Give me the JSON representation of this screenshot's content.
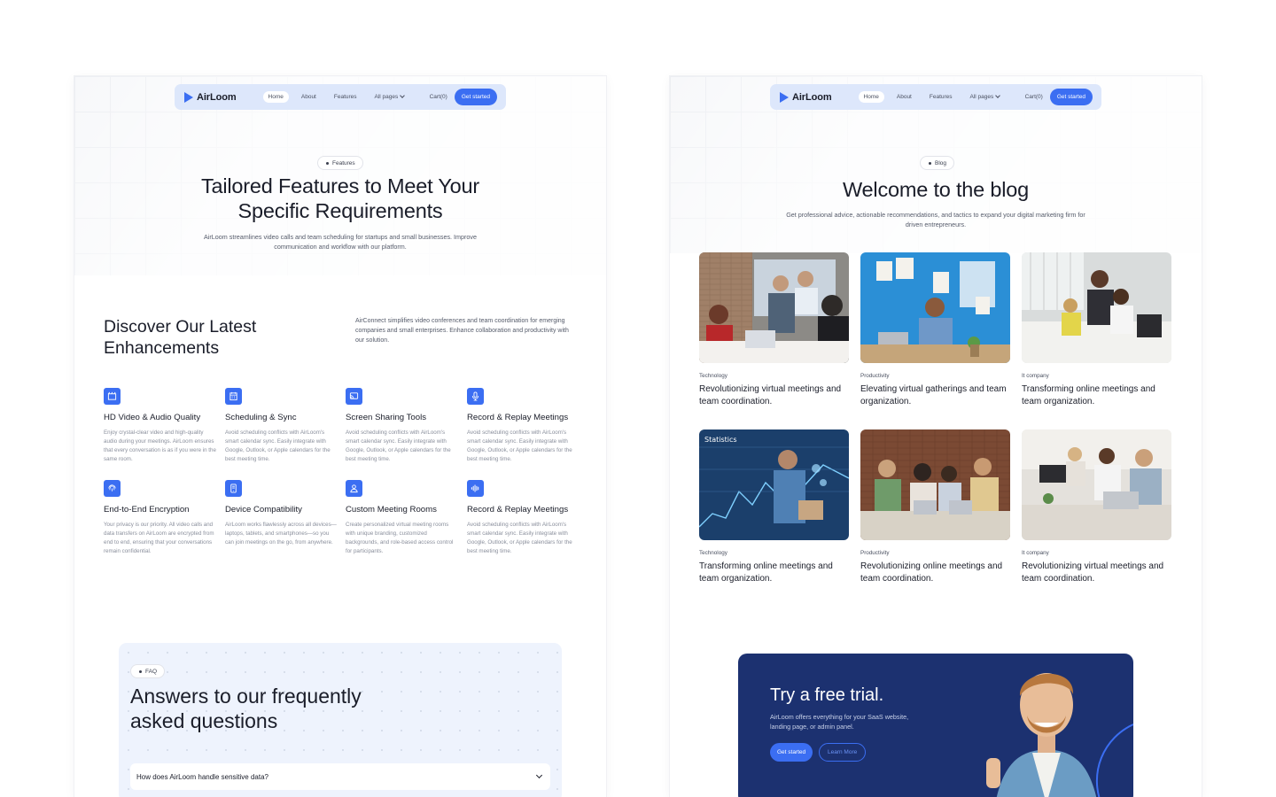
{
  "brand": {
    "name": "AirLoom",
    "accent": "#3b6ef2",
    "dark_panel": "#1c3170"
  },
  "nav": {
    "links": [
      "Home",
      "About",
      "Features",
      "All pages"
    ],
    "cart": "Cart(0)",
    "cta": "Get started"
  },
  "features_page": {
    "pill": "Features",
    "title_line1": "Tailored Features to Meet Your",
    "title_line2": "Specific Requirements",
    "subtitle": "AirLoom streamlines video calls and team scheduling for startups and small businesses. Improve communication and workflow with our platform.",
    "discover_title": "Discover Our Latest Enhancements",
    "discover_desc": "AirConnect simplifies video conferences and team coordination for emerging companies and small enterprises. Enhance collaboration and productivity with our solution.",
    "features": [
      {
        "icon": "video-icon",
        "title": "HD Video & Audio Quality",
        "desc": "Enjoy crystal-clear video and high-quality audio during your meetings. AirLoom ensures that every conversation is as if you were in the same room."
      },
      {
        "icon": "calendar-icon",
        "title": "Scheduling & Sync",
        "desc": "Avoid scheduling conflicts with AirLoom's smart calendar sync. Easily integrate with Google, Outlook, or Apple calendars for the best meeting time."
      },
      {
        "icon": "screen-share-icon",
        "title": "Screen Sharing Tools",
        "desc": "Avoid scheduling conflicts with AirLoom's smart calendar sync. Easily integrate with Google, Outlook, or Apple calendars for the best meeting time."
      },
      {
        "icon": "microphone-icon",
        "title": "Record & Replay Meetings",
        "desc": "Avoid scheduling conflicts with AirLoom's smart calendar sync. Easily integrate with Google, Outlook, or Apple calendars for the best meeting time."
      },
      {
        "icon": "fingerprint-icon",
        "title": "End-to-End Encryption",
        "desc": "Your privacy is our priority. All video calls and data transfers on AirLoom are encrypted from end to end, ensuring that your conversations remain confidential."
      },
      {
        "icon": "device-icon",
        "title": "Device Compatibility",
        "desc": "AirLoom works flawlessly across all devices—laptops, tablets, and smartphones—so you can join meetings on the go, from anywhere."
      },
      {
        "icon": "room-icon",
        "title": "Custom Meeting Rooms",
        "desc": "Create personalized virtual meeting rooms with unique branding, customized backgrounds, and role-based access control for participants."
      },
      {
        "icon": "waveform-icon",
        "title": "Record & Replay Meetings",
        "desc": "Avoid scheduling conflicts with AirLoom's smart calendar sync. Easily integrate with Google, Outlook, or Apple calendars for the best meeting time."
      }
    ],
    "faq_pill": "FAQ",
    "faq_title_line1": "Answers to our frequently",
    "faq_title_line2": "asked questions",
    "faq_question": "How does AirLoom handle sensitive data?"
  },
  "blog_page": {
    "pill": "Blog",
    "title": "Welcome to the blog",
    "subtitle": "Get professional advice, actionable recommendations, and tactics to expand your digital marketing firm for driven entrepreneurs.",
    "posts": [
      {
        "category": "Technology",
        "title": "Revolutionizing virtual meetings and team coordination."
      },
      {
        "category": "Productivity",
        "title": "Elevating virtual gatherings and team organization."
      },
      {
        "category": "It company",
        "title": "Transforming online meetings and team organization."
      },
      {
        "category": "Technology",
        "title": "Transforming online meetings and team organization."
      },
      {
        "category": "Productivity",
        "title": "Revolutionizing online meetings and team coordination."
      },
      {
        "category": "It company",
        "title": "Revolutionizing virtual meetings and team coordination."
      }
    ],
    "photo_overlay_text": "Statistics",
    "trial": {
      "title": "Try a free trial.",
      "subtitle": "AirLoom offers everything for your SaaS website, landing page, or admin panel.",
      "primary": "Get started",
      "secondary": "Learn More"
    }
  }
}
